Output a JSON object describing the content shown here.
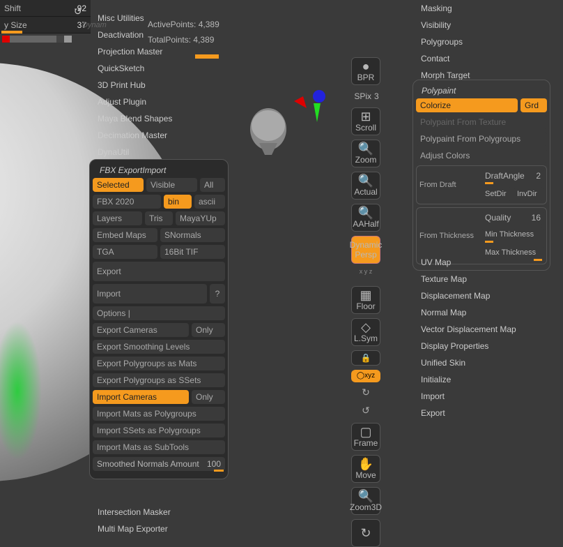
{
  "top_stats": {
    "shift_label": "Shift",
    "shift_value": "-92",
    "size_label": "y Size",
    "size_value": "37"
  },
  "logo_text": "Dynam",
  "points": {
    "active_label": "ActivePoints:",
    "active_value": "4,389",
    "total_label": "TotalPoints:",
    "total_value": "4,389"
  },
  "plugins": [
    "Misc Utilities",
    "Deactivation",
    "Projection Master",
    "QuickSketch",
    "3D Print Hub",
    "Adjust Plugin",
    "Maya Blend Shapes",
    "Decimation Master",
    "DynaUtil"
  ],
  "plugins2": [
    "Intersection Masker",
    "Multi Map Exporter"
  ],
  "fbx": {
    "title": "FBX ExportImport",
    "selected": "Selected",
    "visible": "Visible",
    "all": "All",
    "fbx_version": "FBX 2020",
    "bin": "bin",
    "ascii": "ascii",
    "layers": "Layers",
    "tris": "Tris",
    "mayayup": "MayaYUp",
    "embed_maps": "Embed Maps",
    "snormals": "SNormals",
    "tga": "TGA",
    "tif": "16Bit TIF",
    "export": "Export",
    "import": "Import",
    "qmark": "?",
    "options": "Options  |",
    "export_cameras": "Export Cameras",
    "only1": "Only",
    "export_smooth": "Export Smoothing Levels",
    "export_pg_mats": "Export Polygroups as Mats",
    "export_pg_ssets": "Export Polygroups as SSets",
    "import_cameras": "Import Cameras",
    "only2": "Only",
    "import_mats_pg": "Import Mats as Polygroups",
    "import_ssets_pg": "Import SSets as Polygroups",
    "import_mats_sub": "Import Mats as SubTools",
    "smooth_normals": "Smoothed Normals Amount",
    "smooth_val": "100"
  },
  "right_icons": {
    "bpr": "BPR",
    "spix": "SPix",
    "spix_val": "3",
    "scroll": "Scroll",
    "zoom": "Zoom",
    "actual": "Actual",
    "aahalf": "AAHalf",
    "dynamic": "Dynamic",
    "persp": "Persp",
    "floor": "Floor",
    "lsym": "L.Sym",
    "lock": "🔒",
    "xyz": "◯xyz",
    "rot1": "↻",
    "rot2": "↺",
    "frame": "Frame",
    "move": "Move",
    "zoom3d": "Zoom3D"
  },
  "right_menu": [
    "Masking",
    "Visibility",
    "Polygroups",
    "Contact",
    "Morph Target"
  ],
  "polypaint": {
    "title": "Polypaint",
    "colorize": "Colorize",
    "grd": "Grd",
    "from_texture": "Polypaint From Texture",
    "from_polygroups": "Polypaint From Polygroups",
    "adjust_colors": "Adjust Colors",
    "from_draft": "From Draft",
    "draft_angle": "DraftAngle",
    "draft_angle_val": "2",
    "setdir": "SetDir",
    "invdir": "InvDir",
    "from_thickness": "From Thickness",
    "quality": "Quality",
    "quality_val": "16",
    "min_thick": "Min Thickness",
    "max_thick": "Max Thickness"
  },
  "right_menu2": [
    "UV Map",
    "Texture Map",
    "Displacement Map",
    "Normal Map",
    "Vector Displacement Map",
    "Display Properties",
    "Unified Skin",
    "Initialize",
    "Import",
    "Export"
  ]
}
